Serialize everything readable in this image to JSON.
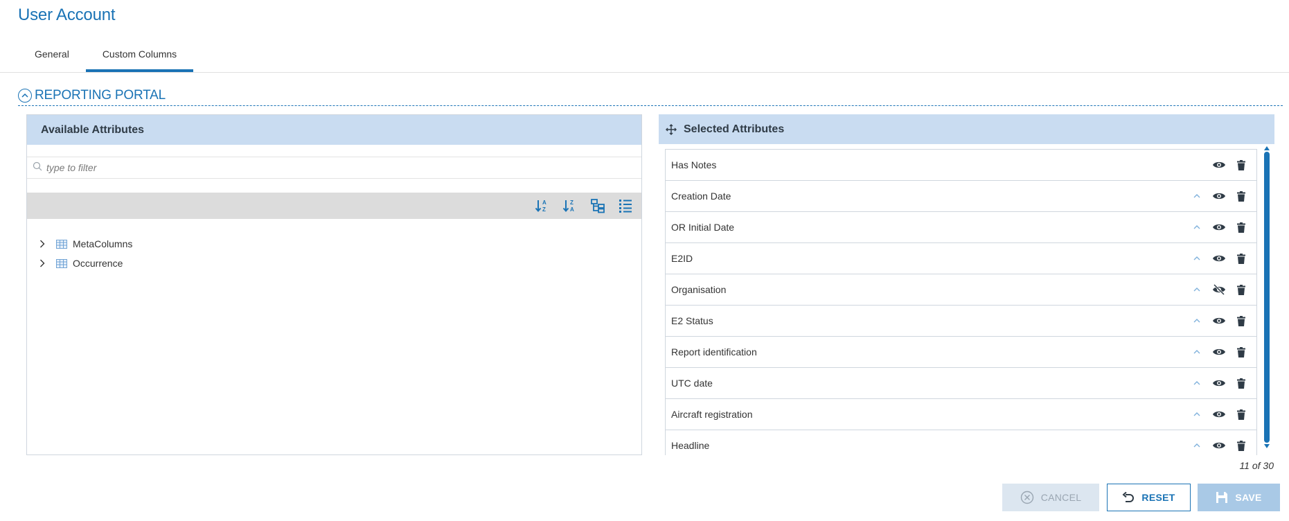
{
  "page": {
    "title": "User Account"
  },
  "tabs": [
    {
      "label": "General",
      "active": false
    },
    {
      "label": "Custom Columns",
      "active": true
    }
  ],
  "section": {
    "title": "REPORTING PORTAL",
    "expanded": true
  },
  "available": {
    "title": "Available Attributes",
    "filter_placeholder": "type to filter",
    "toolbar_icons": [
      "sort-ascending-icon",
      "sort-descending-icon",
      "tree-view-icon",
      "list-view-icon"
    ],
    "tree": [
      {
        "label": "MetaColumns",
        "icon": "table-icon"
      },
      {
        "label": "Occurrence",
        "icon": "table-icon"
      }
    ]
  },
  "selected": {
    "title": "Selected Attributes",
    "items": [
      {
        "label": "Has Notes",
        "visible": true,
        "movable_up": false
      },
      {
        "label": "Creation Date",
        "visible": true,
        "movable_up": true
      },
      {
        "label": "OR Initial Date",
        "visible": true,
        "movable_up": true
      },
      {
        "label": "E2ID",
        "visible": true,
        "movable_up": true
      },
      {
        "label": "Organisation",
        "visible": false,
        "movable_up": true
      },
      {
        "label": "E2 Status",
        "visible": true,
        "movable_up": true
      },
      {
        "label": "Report identification",
        "visible": true,
        "movable_up": true
      },
      {
        "label": "UTC date",
        "visible": true,
        "movable_up": true
      },
      {
        "label": "Aircraft registration",
        "visible": true,
        "movable_up": true
      },
      {
        "label": "Headline",
        "visible": true,
        "movable_up": true
      }
    ],
    "counter": "11 of 30"
  },
  "buttons": {
    "cancel": "CANCEL",
    "reset": "RESET",
    "save": "SAVE"
  },
  "colors": {
    "accent": "#1a73b5",
    "panel_header": "#c9dcf1",
    "toolbar": "#dcdcdc",
    "icon_dark": "#2f3b46"
  }
}
